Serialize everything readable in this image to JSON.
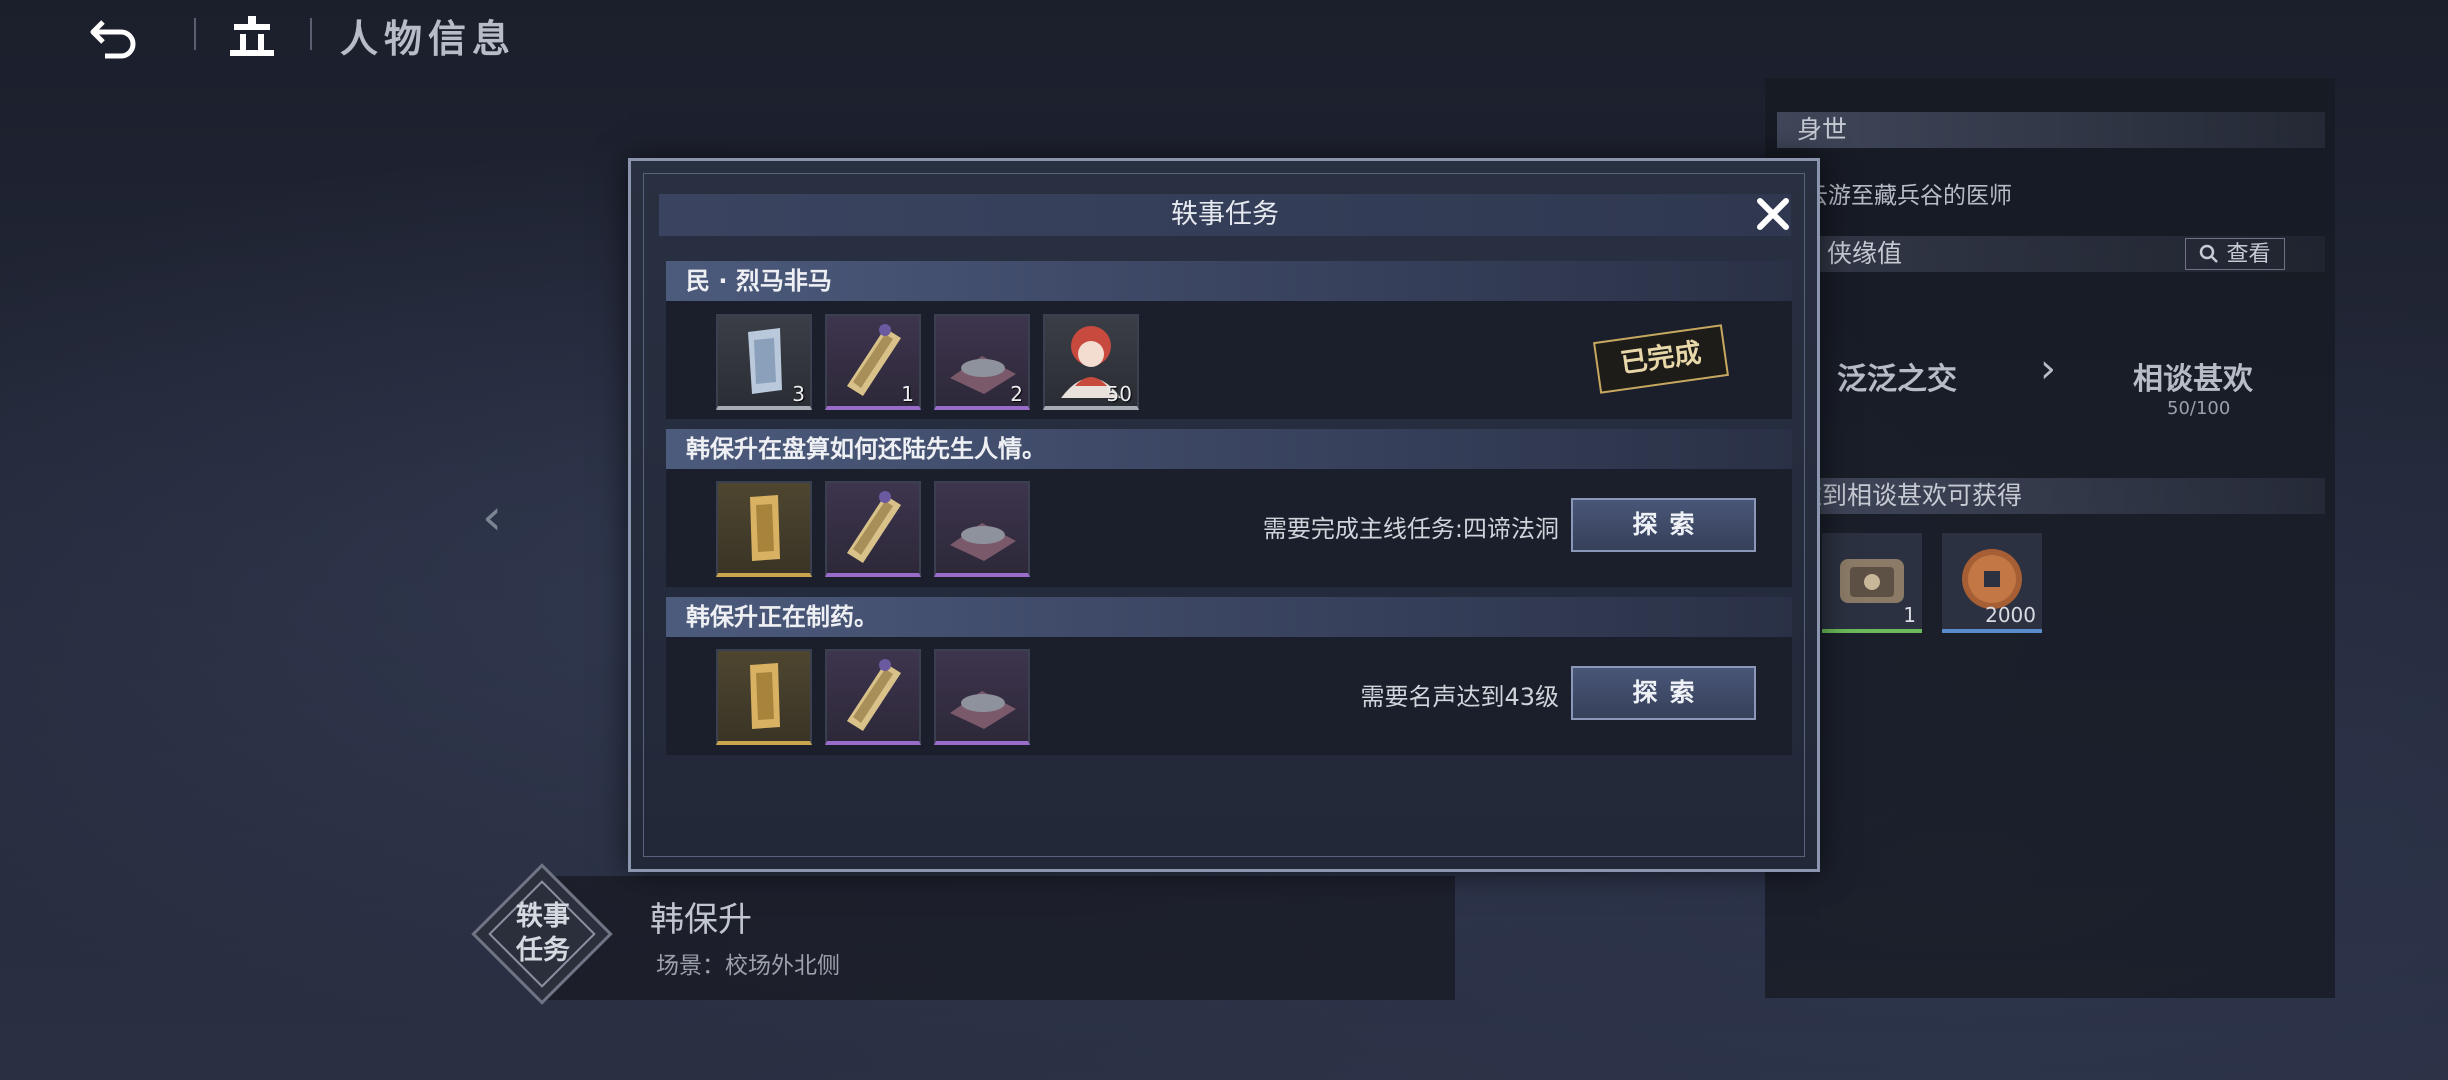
{
  "header": {
    "title": "人物信息"
  },
  "right_panel": {
    "section_origin": "身世",
    "origin_text": "云游至藏兵谷的医师",
    "affinity_label": "侠缘值",
    "search_label": "查看",
    "rank_current": "泛泛之交",
    "rank_next": "相谈甚欢",
    "rank_progress": "50/100",
    "reward_header": "达到相谈甚欢可获得",
    "rewards": [
      {
        "icon": "armor-icon",
        "qty": "1"
      },
      {
        "icon": "coin-icon",
        "qty": "2000"
      }
    ]
  },
  "npc": {
    "badge_line1": "轶事",
    "badge_line2": "任务",
    "name": "韩保升",
    "scene": "场景：校场外北侧"
  },
  "modal": {
    "title": "轶事任务",
    "quests": [
      {
        "title": "民 · 烈马非马",
        "status": "已完成",
        "rewards": [
          {
            "icon": "jade-token-icon",
            "rarity": "white",
            "qty": "3"
          },
          {
            "icon": "scroll-book-icon",
            "rarity": "purple",
            "qty": "1"
          },
          {
            "icon": "ore-powder-icon",
            "rarity": "purple",
            "qty": "2"
          },
          {
            "icon": "character-avatar-icon",
            "rarity": "white",
            "qty": "50"
          }
        ]
      },
      {
        "title": "韩保升在盘算如何还陆先生人情。",
        "requirement": "需要完成主线任务:四谛法洞",
        "button": "探索",
        "rewards": [
          {
            "icon": "gold-token-icon",
            "rarity": "gold",
            "qty": ""
          },
          {
            "icon": "scroll-book-icon",
            "rarity": "purple",
            "qty": ""
          },
          {
            "icon": "ore-powder-icon",
            "rarity": "purple",
            "qty": ""
          }
        ]
      },
      {
        "title": "韩保升正在制药。",
        "requirement": "需要名声达到43级",
        "button": "探索",
        "rewards": [
          {
            "icon": "gold-token-icon",
            "rarity": "gold",
            "qty": ""
          },
          {
            "icon": "scroll-book-icon",
            "rarity": "purple",
            "qty": ""
          },
          {
            "icon": "ore-powder-icon",
            "rarity": "purple",
            "qty": ""
          }
        ]
      }
    ]
  }
}
